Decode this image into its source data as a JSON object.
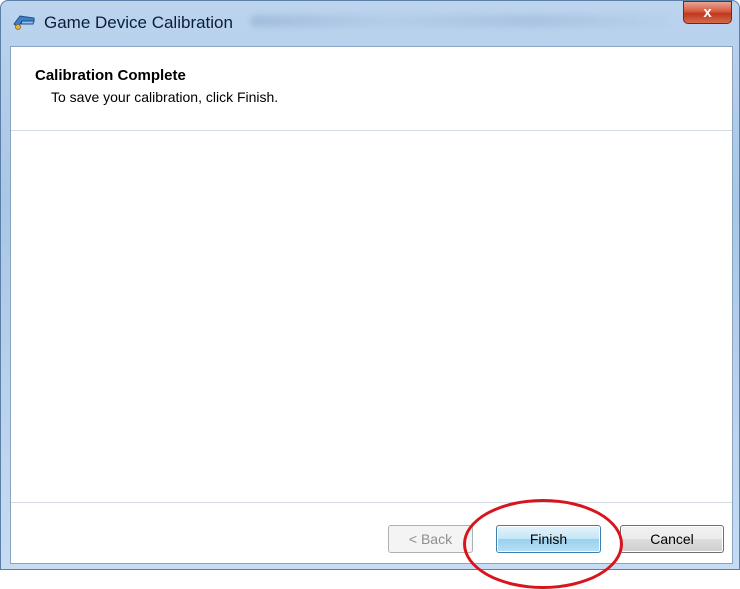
{
  "window": {
    "title": "Game Device Calibration",
    "icon": "game-controller-icon",
    "close_label": "x"
  },
  "header": {
    "title": "Calibration Complete",
    "subtitle": "To save your calibration, click Finish."
  },
  "buttons": {
    "back_label": "< Back",
    "back_enabled": false,
    "finish_label": "Finish",
    "finish_default": true,
    "cancel_label": "Cancel"
  },
  "annotation": {
    "shape": "ellipse",
    "target": "finish-button",
    "color": "#d8141c"
  },
  "colors": {
    "titlebar": "#a9c6e6",
    "close_button": "#c0381d",
    "highlight": "#d8141c"
  }
}
